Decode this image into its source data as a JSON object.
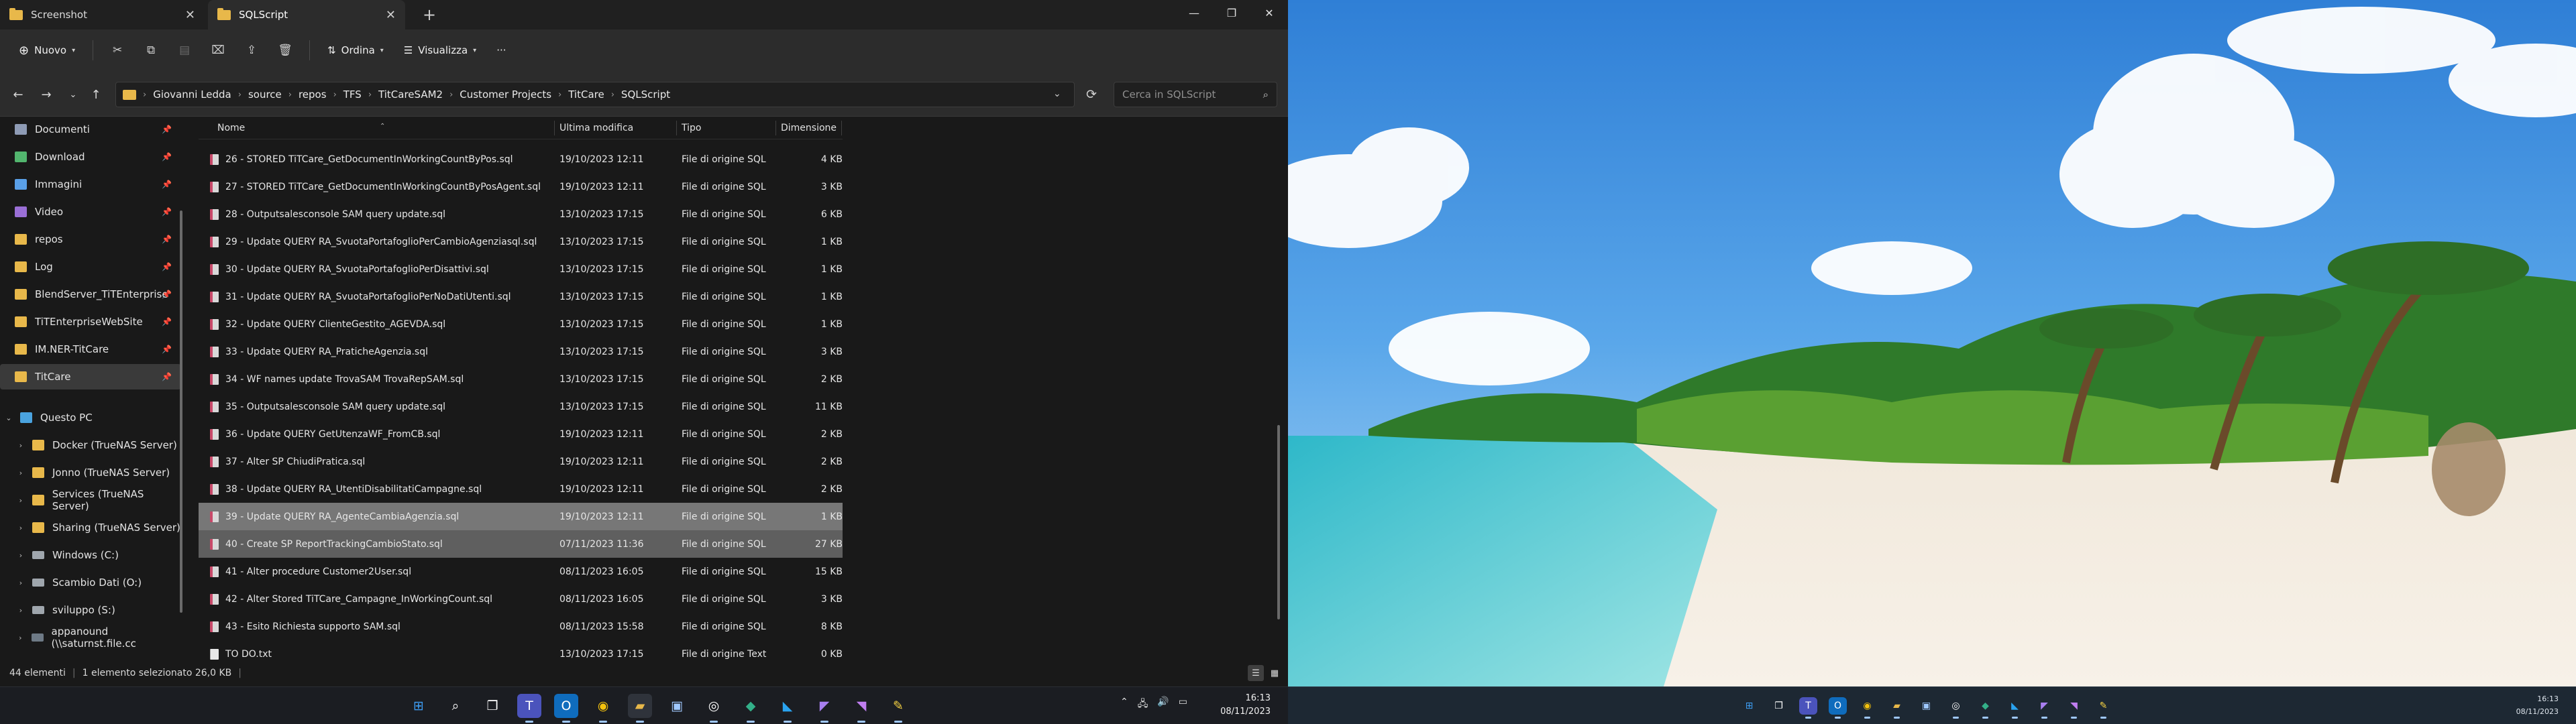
{
  "tabs": [
    {
      "label": "Screenshot",
      "active": false
    },
    {
      "label": "SQLScript",
      "active": true
    }
  ],
  "window_controls": [
    "—",
    "❐",
    "✕"
  ],
  "toolbar": {
    "new_label": "Nuovo",
    "sort_label": "Ordina",
    "view_label": "Visualizza",
    "more_label": "···"
  },
  "breadcrumb": [
    "Giovanni Ledda",
    "source",
    "repos",
    "TFS",
    "TitCareSAM2",
    "Customer Projects",
    "TitCare",
    "SQLScript"
  ],
  "search": {
    "placeholder": "Cerca in SQLScript"
  },
  "nav_quick": [
    {
      "label": "Documenti",
      "icon": "documents-icon"
    },
    {
      "label": "Download",
      "icon": "download-icon"
    },
    {
      "label": "Immagini",
      "icon": "pictures-icon"
    },
    {
      "label": "Video",
      "icon": "video-icon"
    },
    {
      "label": "repos",
      "icon": "folder-icon"
    },
    {
      "label": "Log",
      "icon": "folder-icon"
    },
    {
      "label": "BlendServer_TiTEnterprise",
      "icon": "folder-icon"
    },
    {
      "label": "TiTEnterpriseWebSite",
      "icon": "folder-icon"
    },
    {
      "label": "IM.NER-TitCare",
      "icon": "folder-icon"
    },
    {
      "label": "TitCare",
      "icon": "folder-icon",
      "selected": true
    }
  ],
  "nav_pc": {
    "label": "Questo PC",
    "children": [
      {
        "label": "Docker (TrueNAS Server)",
        "icon": "network-drive-icon"
      },
      {
        "label": "Jonno (TrueNAS Server)",
        "icon": "network-drive-icon"
      },
      {
        "label": "Services (TrueNAS Server)",
        "icon": "network-drive-icon"
      },
      {
        "label": "Sharing (TrueNAS Server)",
        "icon": "network-drive-icon"
      },
      {
        "label": "Windows  (C:)",
        "icon": "drive-icon"
      },
      {
        "label": "Scambio Dati (O:)",
        "icon": "drive-icon"
      },
      {
        "label": "sviluppo (S:)",
        "icon": "drive-icon"
      },
      {
        "label": "appanound (\\\\saturnst.file.cc",
        "icon": "network-drive-icon"
      }
    ]
  },
  "columns": {
    "name": "Nome",
    "date": "Ultima modifica",
    "type": "Tipo",
    "size": "Dimensione"
  },
  "files": [
    {
      "name": "26 - STORED TiTCare_GetDocumentInWorkingCountByPos.sql",
      "date": "19/10/2023 12:11",
      "type": "File di origine SQL",
      "size": "4 KB"
    },
    {
      "name": "27 - STORED TiTCare_GetDocumentInWorkingCountByPosAgent.sql",
      "date": "19/10/2023 12:11",
      "type": "File di origine SQL",
      "size": "3 KB"
    },
    {
      "name": "28 - Outputsalesconsole SAM query update.sql",
      "date": "13/10/2023 17:15",
      "type": "File di origine SQL",
      "size": "6 KB"
    },
    {
      "name": "29 - Update QUERY RA_SvuotaPortafoglioPerCambioAgenziasql.sql",
      "date": "13/10/2023 17:15",
      "type": "File di origine SQL",
      "size": "1 KB"
    },
    {
      "name": "30 - Update QUERY RA_SvuotaPortafoglioPerDisattivi.sql",
      "date": "13/10/2023 17:15",
      "type": "File di origine SQL",
      "size": "1 KB"
    },
    {
      "name": "31 - Update QUERY RA_SvuotaPortafoglioPerNoDatiUtenti.sql",
      "date": "13/10/2023 17:15",
      "type": "File di origine SQL",
      "size": "1 KB"
    },
    {
      "name": "32 - Update QUERY ClienteGestito_AGEVDA.sql",
      "date": "13/10/2023 17:15",
      "type": "File di origine SQL",
      "size": "1 KB"
    },
    {
      "name": "33 - Update QUERY RA_PraticheAgenzia.sql",
      "date": "13/10/2023 17:15",
      "type": "File di origine SQL",
      "size": "3 KB"
    },
    {
      "name": "34 - WF names update TrovaSAM TrovaRepSAM.sql",
      "date": "13/10/2023 17:15",
      "type": "File di origine SQL",
      "size": "2 KB"
    },
    {
      "name": "35 - Outputsalesconsole SAM query update.sql",
      "date": "13/10/2023 17:15",
      "type": "File di origine SQL",
      "size": "11 KB"
    },
    {
      "name": "36 - Update QUERY GetUtenzaWF_FromCB.sql",
      "date": "19/10/2023 12:11",
      "type": "File di origine SQL",
      "size": "2 KB"
    },
    {
      "name": "37 - Alter SP ChiudiPratica.sql",
      "date": "19/10/2023 12:11",
      "type": "File di origine SQL",
      "size": "2 KB"
    },
    {
      "name": "38 - Update QUERY RA_UtentiDisabilitatiCampagne.sql",
      "date": "19/10/2023 12:11",
      "type": "File di origine SQL",
      "size": "2 KB"
    },
    {
      "name": "39 - Update QUERY RA_AgenteCambiaAgenzia.sql",
      "date": "19/10/2023 12:11",
      "type": "File di origine SQL",
      "size": "1 KB",
      "state": "hover"
    },
    {
      "name": "40 - Create SP ReportTrackingCambioStato.sql",
      "date": "07/11/2023 11:36",
      "type": "File di origine SQL",
      "size": "27 KB",
      "state": "selected"
    },
    {
      "name": "41 - Alter procedure Customer2User.sql",
      "date": "08/11/2023 16:05",
      "type": "File di origine SQL",
      "size": "15 KB"
    },
    {
      "name": "42 - Alter Stored TiTCare_Campagne_InWorkingCount.sql",
      "date": "08/11/2023 16:05",
      "type": "File di origine SQL",
      "size": "3 KB"
    },
    {
      "name": "43 - Esito Richiesta supporto SAM.sql",
      "date": "08/11/2023 15:58",
      "type": "File di origine SQL",
      "size": "8 KB"
    },
    {
      "name": "TO DO.txt",
      "date": "13/10/2023 17:15",
      "type": "File di origine Text",
      "size": "0 KB"
    }
  ],
  "status": {
    "count": "44 elementi",
    "selection": "1 elemento selezionato  26,0 KB"
  },
  "taskbar_left": {
    "apps": [
      "start-icon",
      "search-icon",
      "task-view-icon",
      "teams-icon",
      "outlook-icon",
      "chrome-icon",
      "file-explorer-icon",
      "store-icon",
      "obs-icon",
      "gitkraken-icon",
      "vscode-icon",
      "visual-studio-icon",
      "visual-studio-preview-icon",
      "notes-icon"
    ],
    "time": "16:13",
    "date": "08/11/2023"
  },
  "taskbar_right": {
    "time": "16:13",
    "date": "08/11/2023"
  },
  "colors": {
    "accent": "#4aa3df",
    "folder": "#e8b84a",
    "sql_file": "#c94a6a"
  }
}
